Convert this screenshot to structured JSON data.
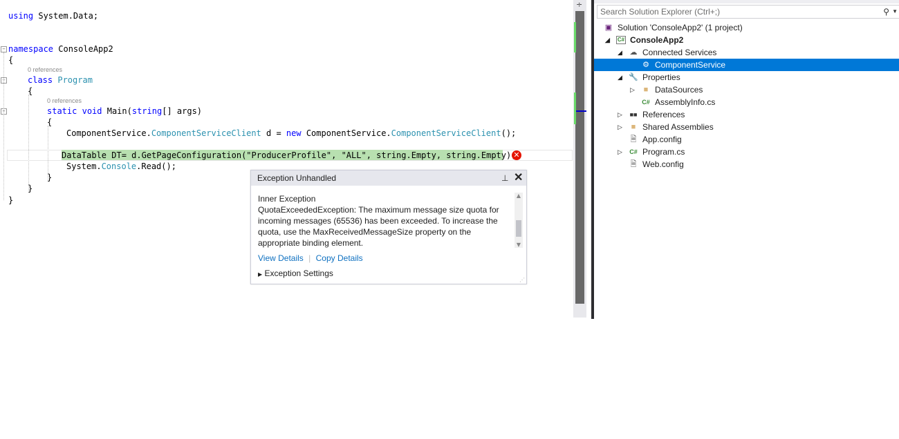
{
  "editor": {
    "lines": {
      "using": "using",
      "using_ns": " System.Data;",
      "namespace_kw": "namespace",
      "namespace_name": " ConsoleApp2",
      "brace_open": "{",
      "brace_close": "}",
      "class_kw": "class",
      "class_name": "Program",
      "static_kw": "static",
      "void_kw": "void",
      "main_sig": " Main(",
      "string_kw": "string",
      "main_args": "[] args)",
      "cs_prefix": "ComponentService.",
      "cs_client": "ComponentServiceClient",
      "cs_var": " d = ",
      "new_kw": "new",
      "cs_prefix2": " ComponentService.",
      "cs_client2": "ComponentServiceClient",
      "cs_end": "();",
      "dt_line": "DataTable DT= d.GetPageConfiguration(\"ProducerProfile\", \"ALL\", string.Empty, string.Empty);",
      "sys_prefix": "System.",
      "sys_console": "Console",
      "sys_read": ".Read();"
    },
    "references_1": "0 references",
    "references_2": "0 references"
  },
  "exception_popup": {
    "title": "Exception Unhandled",
    "inner_label": "Inner Exception",
    "message_lines": [
      "QuotaExceededException: The maximum message size quota for",
      "incoming messages (65536) has been exceeded. To increase the",
      "quota, use the MaxReceivedMessageSize property on the",
      "appropriate binding element."
    ],
    "view_details": "View Details",
    "copy_details": "Copy Details",
    "exception_settings": "Exception Settings"
  },
  "solution_explorer": {
    "search_placeholder": "Search Solution Explorer (Ctrl+;)",
    "items": [
      {
        "label": "Solution 'ConsoleApp2' (1 project)",
        "icon": "solution-icon"
      },
      {
        "label": "ConsoleApp2",
        "icon": "csharp-project-icon"
      },
      {
        "label": "Connected Services",
        "icon": "cloud-icon"
      },
      {
        "label": "ComponentService",
        "icon": "service-icon"
      },
      {
        "label": "Properties",
        "icon": "wrench-icon"
      },
      {
        "label": "DataSources",
        "icon": "folder-icon"
      },
      {
        "label": "AssemblyInfo.cs",
        "icon": "csharp-file-icon"
      },
      {
        "label": "References",
        "icon": "references-icon"
      },
      {
        "label": "Shared Assemblies",
        "icon": "folder-icon"
      },
      {
        "label": "App.config",
        "icon": "config-icon"
      },
      {
        "label": "Program.cs",
        "icon": "csharp-file-icon"
      },
      {
        "label": "Web.config",
        "icon": "config-icon"
      }
    ]
  },
  "colors": {
    "keyword": "#0000ff",
    "type": "#2b91af",
    "selection": "#0078d7",
    "error": "#e51400",
    "highlight": "#b8e0b0"
  }
}
